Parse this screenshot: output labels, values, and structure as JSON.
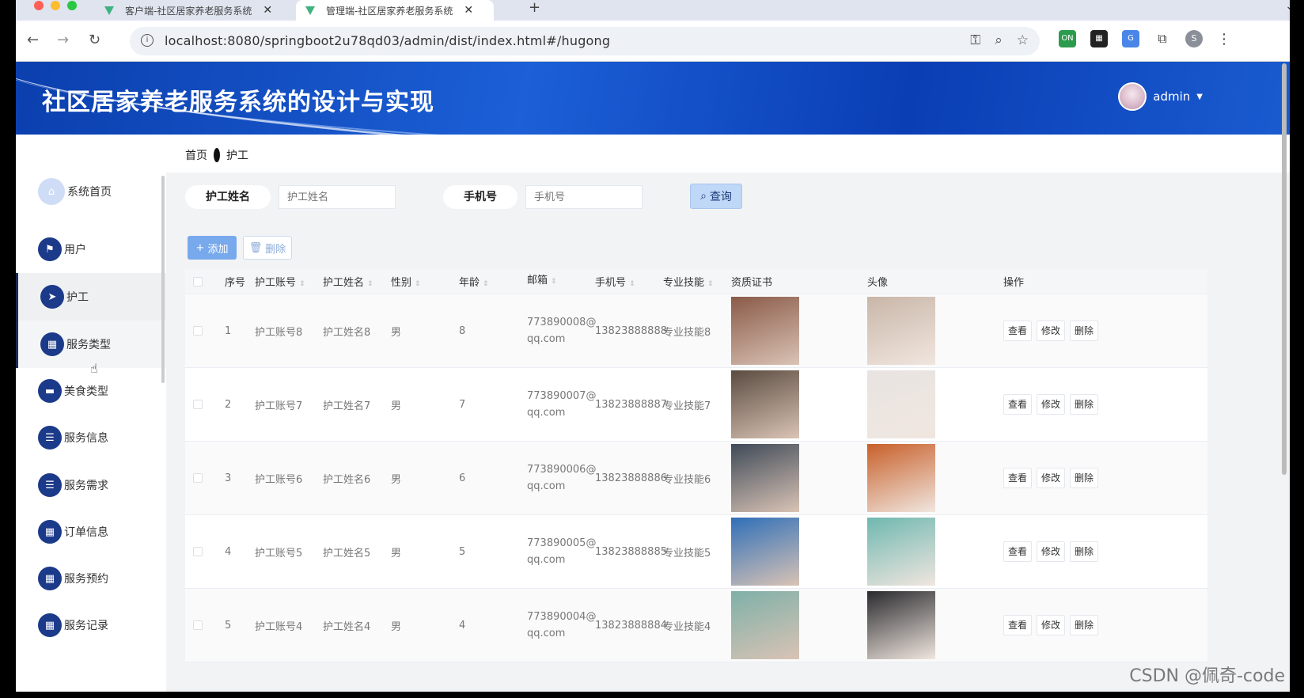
{
  "browser": {
    "tabs": [
      {
        "title": "客户端-社区居家养老服务系统",
        "active": false
      },
      {
        "title": "管理端-社区居家养老服务系统",
        "active": true
      }
    ],
    "url": "localhost:8080/springboot2u78qd03/admin/dist/index.html#/hugong",
    "profile_initial": "S",
    "extension_badge": "ON"
  },
  "header": {
    "title": "社区居家养老服务系统的设计与实现",
    "username": "admin"
  },
  "breadcrumb": {
    "home": "首页",
    "current": "护工"
  },
  "sidebar": {
    "items": [
      {
        "label": "系统首页",
        "icon": "home-icon"
      },
      {
        "label": "用户",
        "icon": "flag-icon"
      },
      {
        "label": "护工",
        "icon": "send-icon",
        "active": true
      },
      {
        "label": "服务类型",
        "icon": "grid-icon"
      },
      {
        "label": "美食类型",
        "icon": "chat-icon"
      },
      {
        "label": "服务信息",
        "icon": "list-icon"
      },
      {
        "label": "服务需求",
        "icon": "list-icon"
      },
      {
        "label": "订单信息",
        "icon": "grid-icon"
      },
      {
        "label": "服务预约",
        "icon": "grid-icon"
      },
      {
        "label": "服务记录",
        "icon": "grid-icon"
      }
    ]
  },
  "search": {
    "name_label": "护工姓名",
    "name_placeholder": "护工姓名",
    "phone_label": "手机号",
    "phone_placeholder": "手机号",
    "query_button": "查询"
  },
  "actions": {
    "add": "添加",
    "delete": "删除"
  },
  "table": {
    "columns": [
      "序号",
      "护工账号",
      "护工姓名",
      "性别",
      "年龄",
      "邮箱",
      "手机号",
      "专业技能",
      "资质证书",
      "头像",
      "操作"
    ],
    "ops": [
      "查看",
      "修改",
      "删除"
    ],
    "rows": [
      {
        "idx": "1",
        "account": "护工账号8",
        "name": "护工姓名8",
        "sex": "男",
        "age": "8",
        "mail1": "773890008@",
        "mail2": "qq.com",
        "phone": "13823888888",
        "skill": "专业技能8",
        "cert_color": "#8a5a48",
        "photo_color": "#c9b6a8"
      },
      {
        "idx": "2",
        "account": "护工账号7",
        "name": "护工姓名7",
        "sex": "男",
        "age": "7",
        "mail1": "773890007@",
        "mail2": "qq.com",
        "phone": "13823888887",
        "skill": "专业技能7",
        "cert_color": "#5a4b40",
        "photo_color": "#e8e4e2"
      },
      {
        "idx": "3",
        "account": "护工账号6",
        "name": "护工姓名6",
        "sex": "男",
        "age": "6",
        "mail1": "773890006@",
        "mail2": "qq.com",
        "phone": "13823888886",
        "skill": "专业技能6",
        "cert_color": "#3f4a58",
        "photo_color": "#c8602a"
      },
      {
        "idx": "4",
        "account": "护工账号5",
        "name": "护工姓名5",
        "sex": "男",
        "age": "5",
        "mail1": "773890005@",
        "mail2": "qq.com",
        "phone": "13823888885",
        "skill": "专业技能5",
        "cert_color": "#2f6fb8",
        "photo_color": "#6fb8b0"
      },
      {
        "idx": "5",
        "account": "护工账号4",
        "name": "护工姓名4",
        "sex": "男",
        "age": "4",
        "mail1": "773890004@",
        "mail2": "qq.com",
        "phone": "13823888884",
        "skill": "专业技能4",
        "cert_color": "#7fb0a8",
        "photo_color": "#2a2a2e"
      }
    ]
  },
  "watermark": "CSDN @佩奇-code"
}
